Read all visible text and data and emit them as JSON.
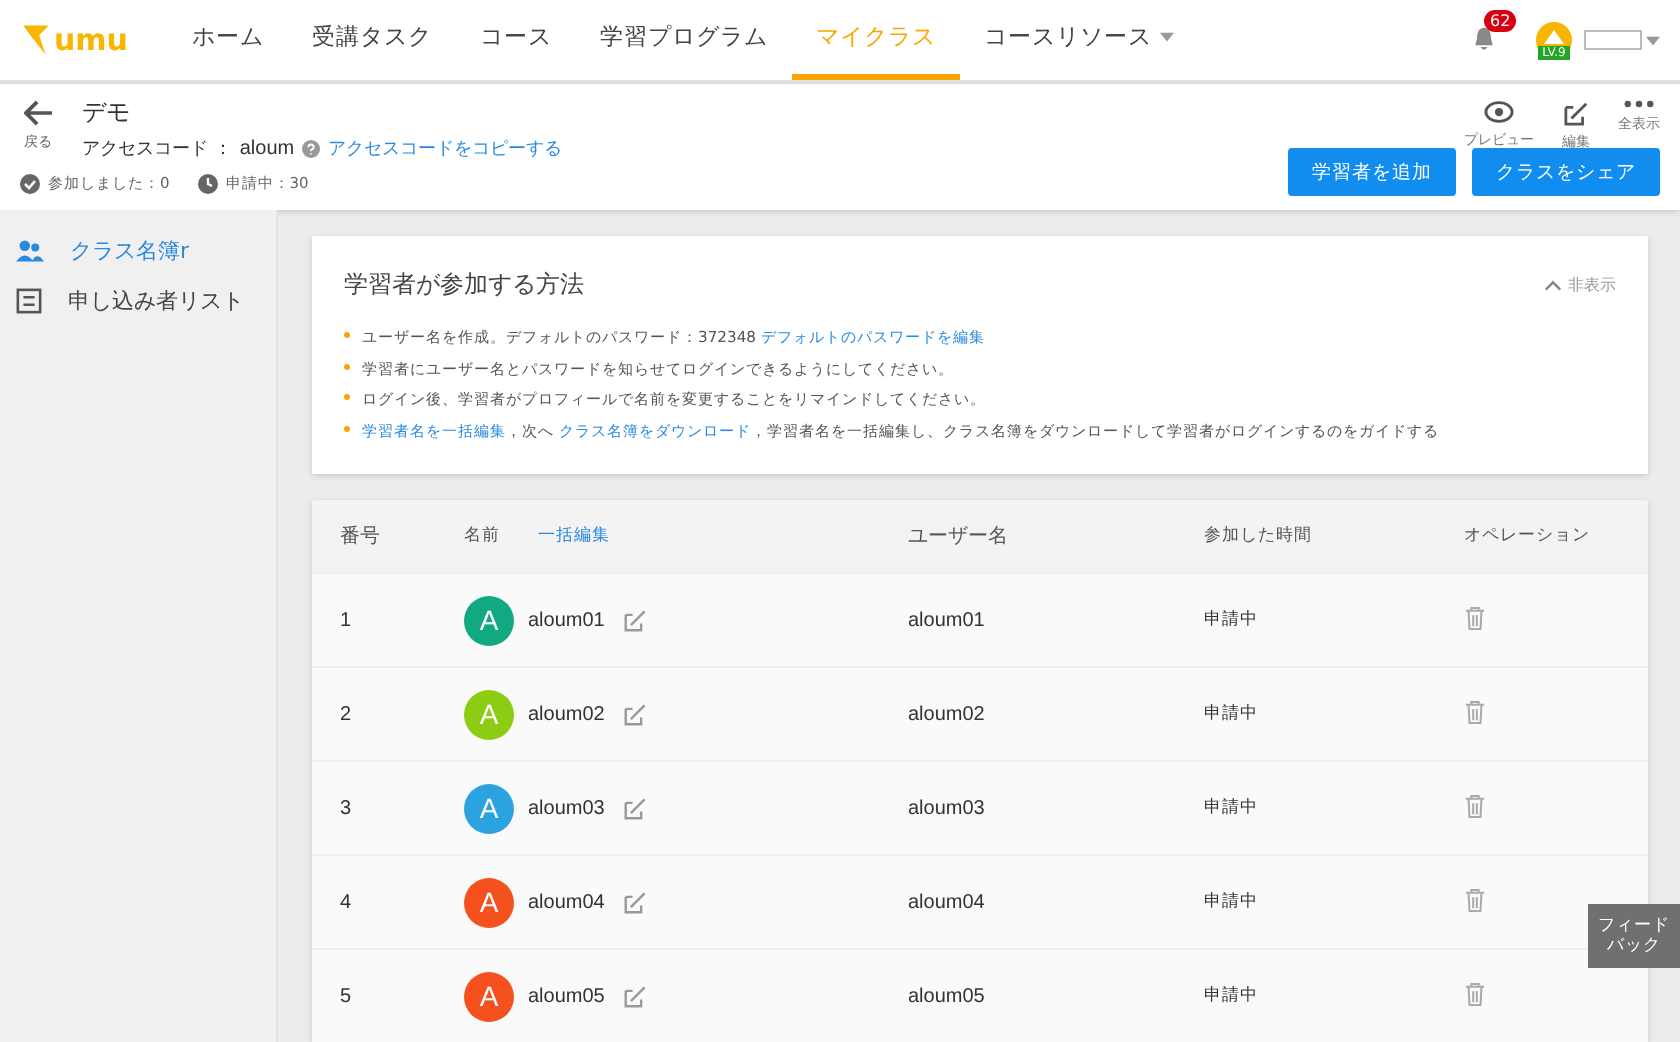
{
  "nav": {
    "logo": "umu",
    "items": [
      {
        "label": "ホーム",
        "selected": false,
        "dropdown": false
      },
      {
        "label": "受講タスク",
        "selected": false,
        "dropdown": false
      },
      {
        "label": "コース",
        "selected": false,
        "dropdown": false
      },
      {
        "label": "学習プログラム",
        "selected": false,
        "dropdown": false
      },
      {
        "label": "マイクラス",
        "selected": true,
        "dropdown": false
      },
      {
        "label": "コースリソース",
        "selected": false,
        "dropdown": true
      }
    ],
    "notifications": "62",
    "level": "LV.9"
  },
  "header": {
    "back": "戻る",
    "title": "デモ",
    "access_label": "アクセスコード ：",
    "access_code": "aloum",
    "copy_link": "アクセスコードをコピーする",
    "joined": "参加しました：0",
    "pending": "申請中：30",
    "actions": [
      {
        "label": "プレビュー",
        "kind": "eye"
      },
      {
        "label": "編集",
        "kind": "edit"
      },
      {
        "label": "全表示",
        "kind": "more"
      }
    ],
    "buttons": [
      "学習者を追加",
      "クラスをシェア"
    ]
  },
  "sidebar": {
    "items": [
      {
        "label": "クラス名簿r",
        "kind": "people",
        "selected": true
      },
      {
        "label": "申し込み者リスト",
        "kind": "list",
        "selected": false
      }
    ]
  },
  "guide": {
    "title": "学習者が参加する方法",
    "hide": "非表示",
    "bullets": [
      [
        {
          "kind": "text",
          "text": "ユーザー名を作成。デフォルトのパスワード：372348 "
        },
        {
          "kind": "link",
          "text": "デフォルトのパスワードを編集"
        }
      ],
      [
        {
          "kind": "text",
          "text": "学習者にユーザー名とパスワードを知らせてログインできるようにしてください。"
        }
      ],
      [
        {
          "kind": "text",
          "text": "ログイン後、学習者がプロフィールで名前を変更することをリマインドしてください。"
        }
      ],
      [
        {
          "kind": "link",
          "text": "学習者名を一括編集"
        },
        {
          "kind": "text",
          "text": "，次へ "
        },
        {
          "kind": "link",
          "text": "クラス名簿をダウンロード"
        },
        {
          "kind": "text",
          "text": "，学習者名を一括編集し、クラス名簿をダウンロードして学習者がログインするのをガイドする"
        }
      ]
    ]
  },
  "table": {
    "columns": [
      "番号",
      "名前",
      "ユーザー名",
      "参加した時間",
      "オペレーション"
    ],
    "bulk_edit": "一括編集",
    "rows": [
      {
        "no": "1",
        "initial": "A",
        "color": "#12a882",
        "name": "aloum01",
        "username": "aloum01",
        "time": "申請中"
      },
      {
        "no": "2",
        "initial": "A",
        "color": "#8ccc12",
        "name": "aloum02",
        "username": "aloum02",
        "time": "申請中"
      },
      {
        "no": "3",
        "initial": "A",
        "color": "#2ba3e0",
        "name": "aloum03",
        "username": "aloum03",
        "time": "申請中"
      },
      {
        "no": "4",
        "initial": "A",
        "color": "#f4511e",
        "name": "aloum04",
        "username": "aloum04",
        "time": "申請中"
      },
      {
        "no": "5",
        "initial": "A",
        "color": "#f4511e",
        "name": "aloum05",
        "username": "aloum05",
        "time": "申請中"
      }
    ]
  },
  "feedback": "フィードバック"
}
